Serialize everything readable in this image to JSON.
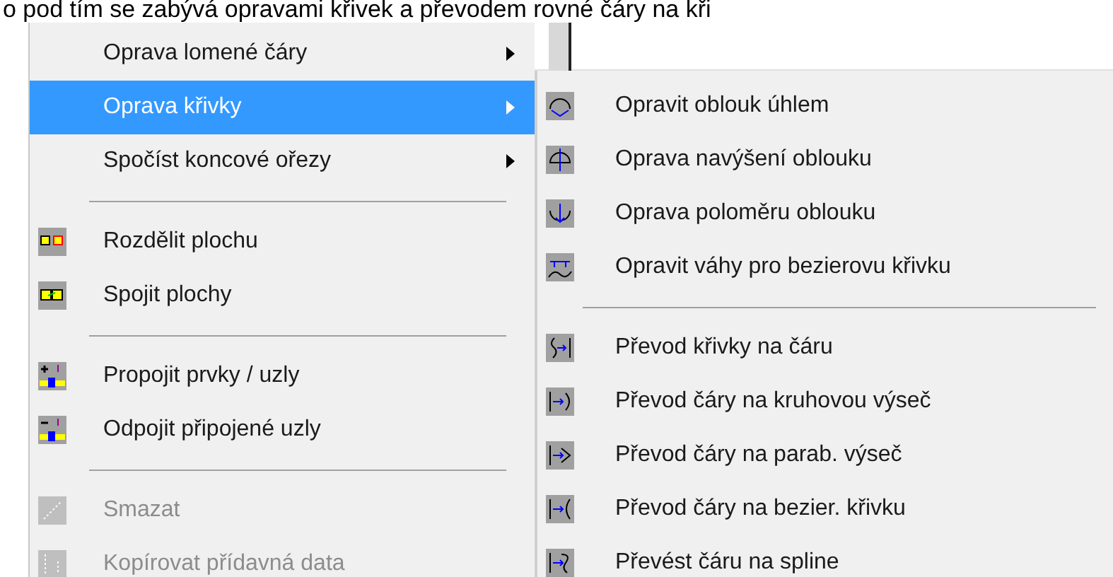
{
  "caption": "o pod tím se zabývá opravami křivek a převodem rovné čáry na kři",
  "menu": {
    "items": [
      {
        "kind": "item",
        "label": "Oprava lomené čáry",
        "submenu": true,
        "selected": false,
        "disabled": false
      },
      {
        "kind": "item",
        "label": "Oprava křivky",
        "submenu": true,
        "selected": true,
        "disabled": false
      },
      {
        "kind": "item",
        "label": "Spočíst koncové ořezy",
        "submenu": true,
        "selected": false,
        "disabled": false
      },
      {
        "kind": "separator"
      },
      {
        "kind": "item",
        "label": "Rozdělit plochu",
        "submenu": false,
        "selected": false,
        "disabled": false
      },
      {
        "kind": "item",
        "label": "Spojit plochy",
        "submenu": false,
        "selected": false,
        "disabled": false
      },
      {
        "kind": "separator"
      },
      {
        "kind": "item",
        "label": "Propojit prvky / uzly",
        "submenu": false,
        "selected": false,
        "disabled": false
      },
      {
        "kind": "item",
        "label": "Odpojit připojené uzly",
        "submenu": false,
        "selected": false,
        "disabled": false
      },
      {
        "kind": "separator"
      },
      {
        "kind": "item",
        "label": "Smazat",
        "submenu": false,
        "selected": false,
        "disabled": true
      },
      {
        "kind": "item",
        "label": "Kopírovat přídavná data",
        "submenu": false,
        "selected": false,
        "disabled": true
      }
    ]
  },
  "submenu": {
    "items": [
      {
        "kind": "item",
        "label": "Opravit oblouk úhlem"
      },
      {
        "kind": "item",
        "label": "Oprava navýšení oblouku"
      },
      {
        "kind": "item",
        "label": "Oprava poloměru oblouku"
      },
      {
        "kind": "item",
        "label": "Opravit váhy pro bezierovu křivku"
      },
      {
        "kind": "separator"
      },
      {
        "kind": "item",
        "label": "Převod křivky na čáru"
      },
      {
        "kind": "item",
        "label": "Převod čáry na kruhovou výseč"
      },
      {
        "kind": "item",
        "label": "Převod čáry na parab. výseč"
      },
      {
        "kind": "item",
        "label": "Převod čáry na bezier. křivku"
      },
      {
        "kind": "item",
        "label": "Převést čáru na spline"
      }
    ]
  }
}
